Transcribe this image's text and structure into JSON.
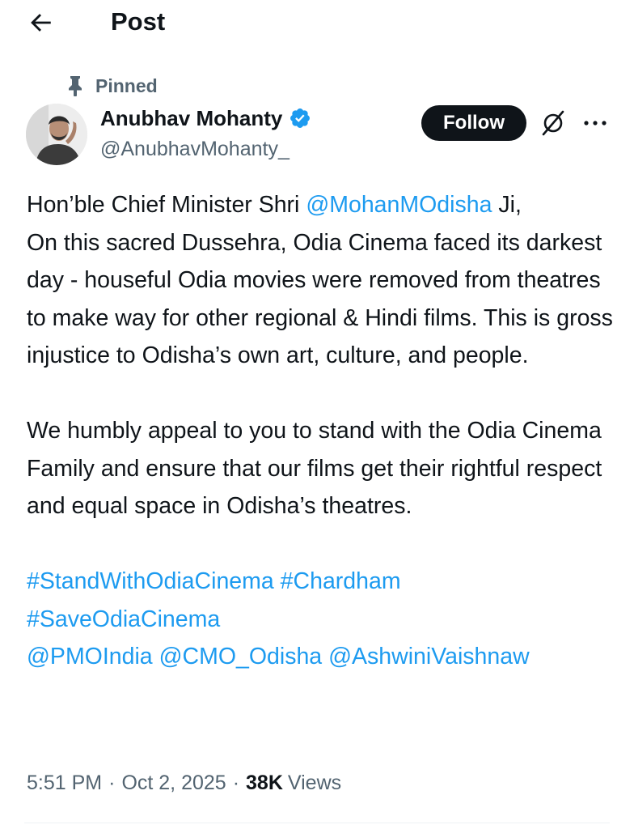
{
  "header": {
    "title": "Post"
  },
  "post": {
    "pinned_label": "Pinned",
    "author": {
      "name": "Anubhav Mohanty",
      "handle": "@AnubhavMohanty_",
      "verified": true
    },
    "follow_label": "Follow",
    "body": {
      "p1": {
        "prefix": "Hon’ble Chief Minister Shri ",
        "mention": "@MohanMOdisha",
        "suffix": " Ji,",
        "line2": "On this sacred Dussehra, Odia Cinema faced its darkest day - houseful Odia movies were removed from theatres to make way for other regional & Hindi films. This is gross injustice to Odisha’s own art, culture, and people."
      },
      "p2": "We humbly appeal to you to stand with the Odia Cinema Family and ensure that our films get their rightful respect and equal space in Odisha’s theatres.",
      "hashtags": [
        "#StandWithOdiaCinema",
        "#Chardham",
        "#SaveOdiaCinema"
      ],
      "mentions": [
        "@PMOIndia",
        "@CMO_Odisha",
        "@AshwiniVaishnaw"
      ]
    },
    "time": "5:51 PM",
    "date": "Oct 2, 2025",
    "views_count": "38K",
    "views_label": "Views"
  },
  "icons": {
    "back": "arrow-left-icon",
    "pin": "pin-icon",
    "verified": "verified-badge-icon",
    "grok": "grok-icon",
    "more": "more-horizontal-icon"
  },
  "colors": {
    "text": "#0f1419",
    "secondary": "#536471",
    "link": "#1d9bf0",
    "follow_bg": "#0f1419",
    "follow_text": "#ffffff"
  }
}
